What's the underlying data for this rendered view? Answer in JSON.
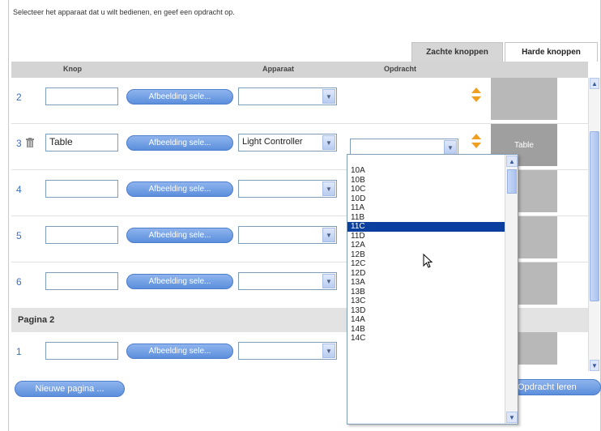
{
  "instruction": "Selecteer het apparaat dat u wilt bedienen, en geef een opdracht op.",
  "tabs": {
    "soft": "Zachte knoppen",
    "hard": "Harde knoppen"
  },
  "header": {
    "knop": "Knop",
    "apparaat": "Apparaat",
    "opdracht": "Opdracht"
  },
  "image_button_label": "Afbeelding sele...",
  "rows": [
    {
      "num": "2",
      "name": "",
      "device": "",
      "preview": ""
    },
    {
      "num": "3",
      "name": "Table",
      "device": "Light Controller",
      "preview": "Table"
    },
    {
      "num": "4",
      "name": "",
      "device": "",
      "preview": ""
    },
    {
      "num": "5",
      "name": "",
      "device": "",
      "preview": ""
    },
    {
      "num": "6",
      "name": "",
      "device": "",
      "preview": ""
    }
  ],
  "page2": {
    "label": "Pagina 2",
    "rows": [
      {
        "num": "1",
        "name": "",
        "device": ""
      }
    ]
  },
  "dropdown_items": [
    "10A",
    "10B",
    "10C",
    "10D",
    "11A",
    "11B",
    "11C",
    "11D",
    "12A",
    "12B",
    "12C",
    "12D",
    "13A",
    "13B",
    "13C",
    "13D",
    "14A",
    "14B",
    "14C"
  ],
  "dropdown_selected": "11C",
  "bottom": {
    "new_page": "Nieuwe pagina ...",
    "learn": "Opdracht leren"
  },
  "colors": {
    "accent": "#5b8fdc",
    "selection": "#0a3fa0",
    "arrow": "#f0a020"
  }
}
